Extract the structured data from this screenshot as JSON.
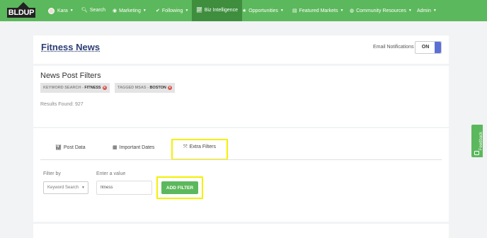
{
  "nav": {
    "logo": "BLDUP",
    "user": "Kara",
    "search": "Search",
    "marketing": "Marketing",
    "following": "Following",
    "biz_intel": "Biz Intelligence",
    "opportunities": "Opportunities",
    "featured_markets": "Featured Markets",
    "community": "Community Resources",
    "admin": "Admin",
    "accent": "#5cb85c",
    "active_bg": "#3e8e3e"
  },
  "header": {
    "title": "Fitness News",
    "email_label": "Email Notifications",
    "toggle_state": "ON"
  },
  "filters": {
    "heading": "News Post Filters",
    "chips": [
      {
        "key": "KEYWORD SEARCH - ",
        "value": "FITNESS"
      },
      {
        "key": "TAGGED MSAS - ",
        "value": "BOSTON"
      }
    ],
    "results": "Results Found: 927"
  },
  "tabs": [
    {
      "label": "Post Data",
      "icon": "chart-icon"
    },
    {
      "label": "Important Dates",
      "icon": "calendar-icon"
    },
    {
      "label": "Extra Filters",
      "icon": "expand-icon"
    }
  ],
  "extra_filters": {
    "filter_by_label": "Filter by",
    "filter_by_value": "Keyword Search",
    "value_label": "Enter a value",
    "value": "fitness",
    "add_button": "ADD FILTER"
  },
  "feedback": "Feedback"
}
